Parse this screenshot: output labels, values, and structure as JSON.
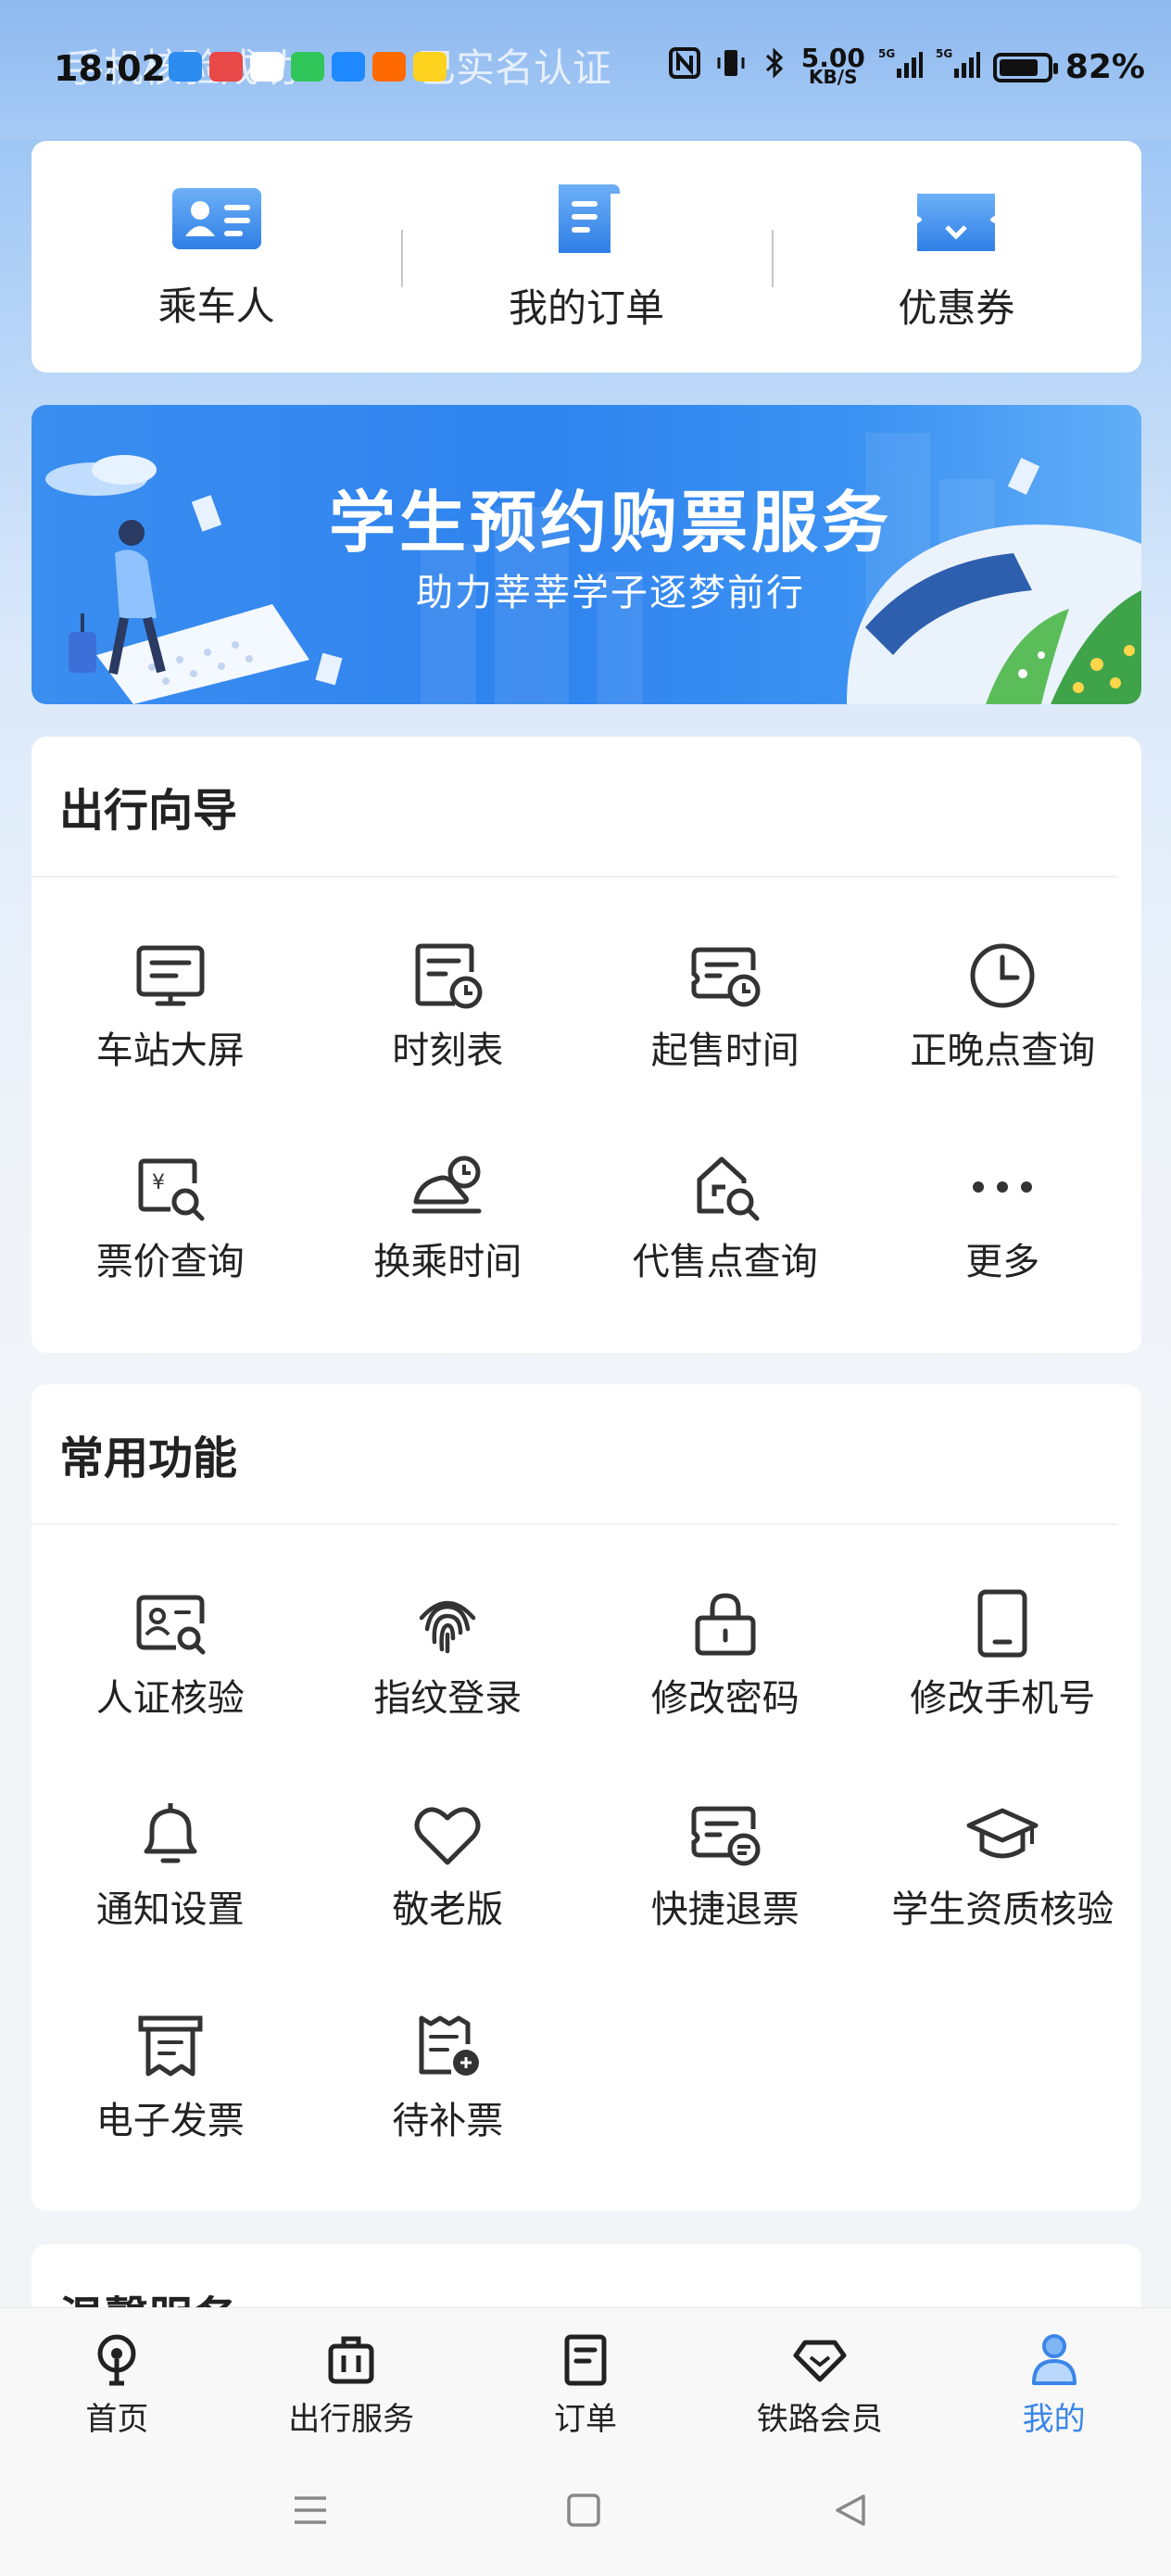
{
  "status_bar": {
    "time": "18:02",
    "faded_left": "手机核验成功",
    "faded_right": "已实名认证",
    "net_speed": "5.00",
    "net_unit": "KB/S",
    "battery": "82%"
  },
  "quick_links": [
    {
      "label": "乘车人",
      "icon": "passenger-card-icon"
    },
    {
      "label": "我的订单",
      "icon": "order-document-icon"
    },
    {
      "label": "优惠券",
      "icon": "coupon-icon"
    }
  ],
  "banner": {
    "title": "学生预约购票服务",
    "subtitle": "助力莘莘学子逐梦前行"
  },
  "travel_guide": {
    "title": "出行向导",
    "items": [
      {
        "label": "车站大屏",
        "icon": "station-screen-icon"
      },
      {
        "label": "时刻表",
        "icon": "timetable-icon"
      },
      {
        "label": "起售时间",
        "icon": "sale-time-icon"
      },
      {
        "label": "正晚点查询",
        "icon": "clock-icon"
      },
      {
        "label": "票价查询",
        "icon": "fare-search-icon"
      },
      {
        "label": "换乘时间",
        "icon": "transfer-time-icon"
      },
      {
        "label": "代售点查询",
        "icon": "agency-search-icon"
      },
      {
        "label": "更多",
        "icon": "more-dots-icon"
      }
    ]
  },
  "common_functions": {
    "title": "常用功能",
    "items": [
      {
        "label": "人证核验",
        "icon": "id-verify-icon"
      },
      {
        "label": "指纹登录",
        "icon": "fingerprint-icon"
      },
      {
        "label": "修改密码",
        "icon": "lock-icon"
      },
      {
        "label": "修改手机号",
        "icon": "phone-icon"
      },
      {
        "label": "通知设置",
        "icon": "bell-icon"
      },
      {
        "label": "敬老版",
        "icon": "heart-icon"
      },
      {
        "label": "快捷退票",
        "icon": "refund-ticket-icon"
      },
      {
        "label": "学生资质核验",
        "icon": "graduation-cap-icon"
      },
      {
        "label": "电子发票",
        "icon": "invoice-icon"
      },
      {
        "label": "待补票",
        "icon": "supplement-ticket-icon"
      }
    ]
  },
  "next_section_title": "温馨服务",
  "bottom_nav": [
    {
      "label": "首页",
      "icon": "home-train-icon",
      "active": false
    },
    {
      "label": "出行服务",
      "icon": "luggage-icon",
      "active": false
    },
    {
      "label": "订单",
      "icon": "order-icon",
      "active": false
    },
    {
      "label": "铁路会员",
      "icon": "member-diamond-icon",
      "active": false
    },
    {
      "label": "我的",
      "icon": "profile-icon",
      "active": true
    }
  ],
  "colors": {
    "accent": "#3a86e8",
    "banner_blue": "#2f83ee",
    "text": "#222222"
  }
}
